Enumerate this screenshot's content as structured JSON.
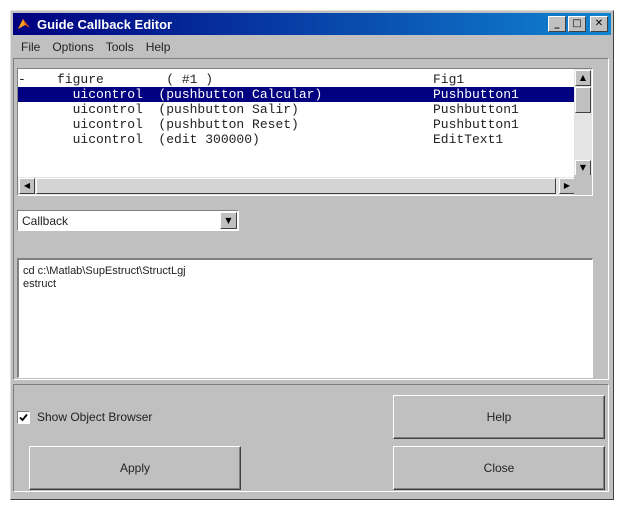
{
  "window": {
    "title": "Guide Callback Editor"
  },
  "titlebar_buttons": {
    "minimize": "_",
    "maximize": "□",
    "close": "✕"
  },
  "menu": [
    "File",
    "Options",
    "Tools",
    "Help"
  ],
  "object_list": {
    "rows": [
      {
        "name": "-    figure        ( #1 )",
        "tag": "Fig1",
        "selected": false
      },
      {
        "name": "       uicontrol  (pushbutton Calcular)",
        "tag": "Pushbutton1",
        "selected": true
      },
      {
        "name": "       uicontrol  (pushbutton Salir)",
        "tag": "Pushbutton1",
        "selected": false
      },
      {
        "name": "       uicontrol  (pushbutton Reset)",
        "tag": "Pushbutton1",
        "selected": false
      },
      {
        "name": "       uicontrol  (edit 300000)",
        "tag": "EditText1",
        "selected": false
      }
    ]
  },
  "property_select": {
    "value": "Callback"
  },
  "code": {
    "lines": [
      "cd c:\\Matlab\\SupEstruct\\StructLgj",
      "estruct"
    ]
  },
  "show_object_browser": {
    "label": "Show Object Browser",
    "checked": true
  },
  "buttons": {
    "help": "Help",
    "apply": "Apply",
    "close": "Close"
  }
}
